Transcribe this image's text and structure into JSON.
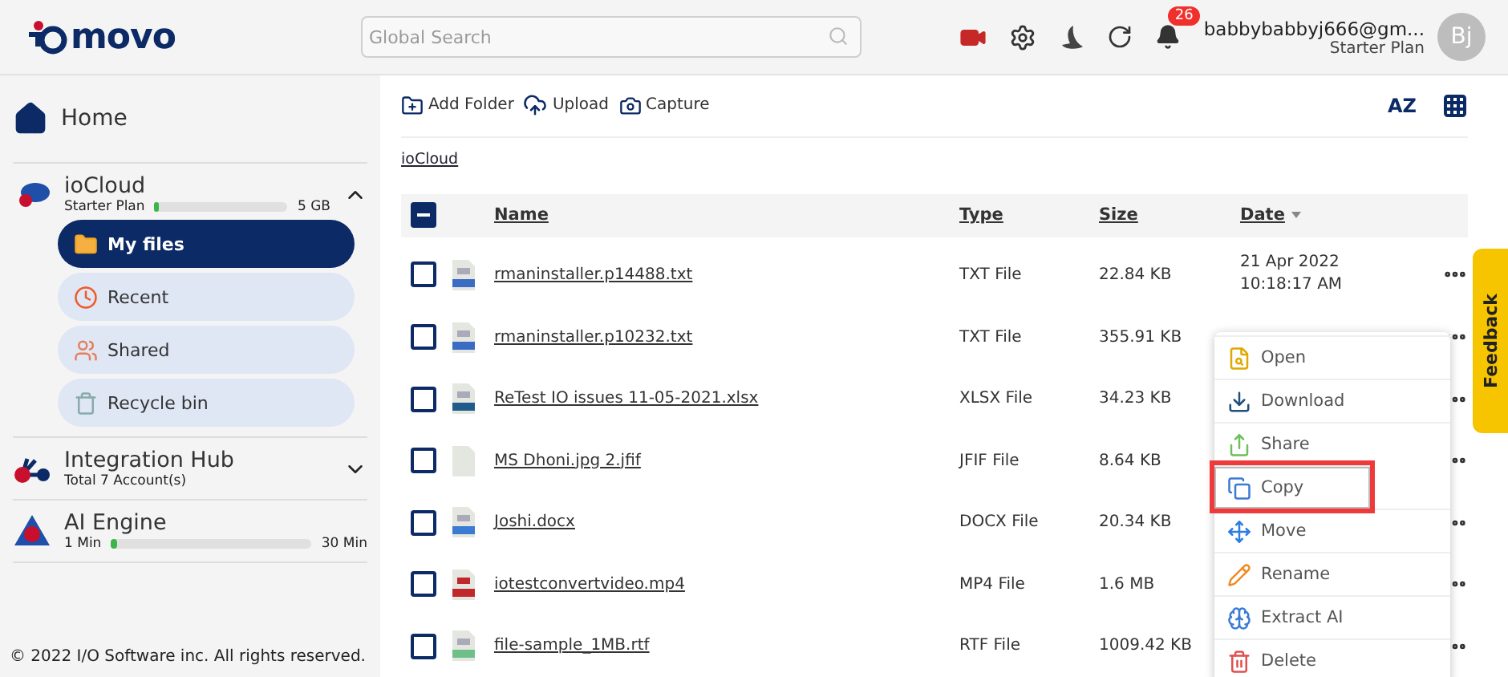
{
  "header": {
    "logo": "movo",
    "search": {
      "placeholder": "Global Search"
    },
    "notifications": "26",
    "user": {
      "email": "babbybabbyj666@gm...",
      "plan": "Starter Plan",
      "initials": "Bj"
    }
  },
  "sidebar": {
    "home": "Home",
    "sections": [
      {
        "kind": "cloud",
        "title": "ioCloud",
        "expanded": true,
        "meter": {
          "left": "Starter Plan",
          "level": 0.02,
          "right": "5 GB"
        },
        "items": [
          {
            "label": "My files",
            "kind": "folder",
            "selected": true
          },
          {
            "label": "Recent",
            "kind": "recent",
            "selected": false
          },
          {
            "label": "Shared",
            "kind": "shared",
            "selected": false
          },
          {
            "label": "Recycle bin",
            "kind": "bin",
            "selected": false
          }
        ]
      },
      {
        "kind": "hub",
        "title": "Integration Hub",
        "expanded": false,
        "subtitle": "Total 7 Account(s)"
      },
      {
        "kind": "ai",
        "title": "AI Engine",
        "meter": {
          "left": "1 Min",
          "level": 0.03,
          "right": "30 Min"
        }
      }
    ],
    "footer": "© 2022 I/O Software inc. All rights reserved."
  },
  "toolbar": {
    "actions": [
      {
        "label": "Add Folder",
        "kind": "folder"
      },
      {
        "label": "Upload",
        "kind": "upload"
      },
      {
        "label": "Capture",
        "kind": "camera"
      }
    ],
    "sort": "AZ"
  },
  "breadcrumb": "ioCloud",
  "table": {
    "select_all": {
      "indeterminate": true
    },
    "columns": [
      "Name",
      "Type",
      "Size",
      "Date"
    ],
    "rows": [
      {
        "kind": "txt",
        "name": "rmaninstaller.p14488.txt",
        "type": "TXT File",
        "size": "22.84 KB",
        "date": "21 Apr 2022",
        "time": "10:18:17 AM",
        "checked": false
      },
      {
        "kind": "txt",
        "name": "rmaninstaller.p10232.txt",
        "type": "TXT File",
        "size": "355.91 KB",
        "checked": false
      },
      {
        "kind": "xlsx",
        "name": "ReTest IO issues 11-05-2021.xlsx",
        "type": "XLSX File",
        "size": "34.23 KB",
        "checked": false
      },
      {
        "kind": "blank",
        "name": "MS Dhoni.jpg 2.jfif",
        "type": "JFIF File",
        "size": "8.64 KB",
        "checked": false
      },
      {
        "kind": "docx",
        "name": "Joshi.docx",
        "type": "DOCX File",
        "size": "20.34 KB",
        "checked": false
      },
      {
        "kind": "mp4",
        "name": "iotestconvertvideo.mp4",
        "type": "MP4 File",
        "size": "1.6 MB",
        "checked": false
      },
      {
        "kind": "rtf",
        "name": "file-sample_1MB.rtf",
        "type": "RTF File",
        "size": "1009.42 KB",
        "checked": false
      }
    ]
  },
  "context_menu": [
    {
      "label": "Open",
      "kind": "open",
      "highlighted": false
    },
    {
      "label": "Download",
      "kind": "download",
      "highlighted": false
    },
    {
      "label": "Share",
      "kind": "share",
      "highlighted": false
    },
    {
      "label": "Copy",
      "kind": "copy",
      "highlighted": true
    },
    {
      "label": "Move",
      "kind": "move",
      "highlighted": false
    },
    {
      "label": "Rename",
      "kind": "rename",
      "highlighted": false
    },
    {
      "label": "Extract AI",
      "kind": "extract",
      "highlighted": false
    },
    {
      "label": "Delete",
      "kind": "delete",
      "highlighted": false
    }
  ],
  "feedback": "Feedback"
}
